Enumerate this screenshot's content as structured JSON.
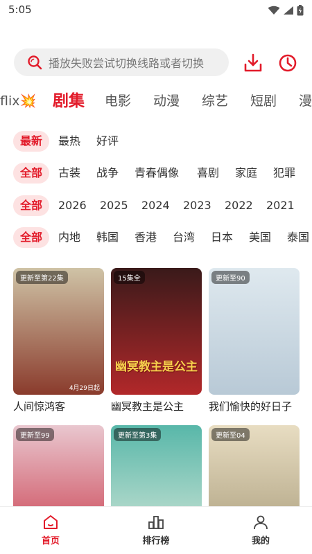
{
  "status": {
    "time": "5:05"
  },
  "search": {
    "placeholder": "播放失败尝试切换线路或者切换"
  },
  "tabs": [
    {
      "label": "flix💥"
    },
    {
      "label": "剧集",
      "active": true
    },
    {
      "label": "电影"
    },
    {
      "label": "动漫"
    },
    {
      "label": "综艺"
    },
    {
      "label": "短剧"
    },
    {
      "label": "漫"
    }
  ],
  "filters": {
    "sort": [
      "最新",
      "最热",
      "好评"
    ],
    "genre": [
      "全部",
      "古装",
      "战争",
      "青春偶像",
      "喜剧",
      "家庭",
      "犯罪"
    ],
    "year": [
      "全部",
      "2026",
      "2025",
      "2024",
      "2023",
      "2022",
      "2021"
    ],
    "region": [
      "全部",
      "内地",
      "韩国",
      "香港",
      "台湾",
      "日本",
      "美国",
      "泰国"
    ]
  },
  "cards": [
    {
      "title": "人间惊鸿客",
      "badge": "更新至第22集",
      "date": "4月29日起",
      "colors": [
        "#cfc3a6",
        "#8a3b2c"
      ]
    },
    {
      "title": "幽冥教主是公主",
      "badge": "15集全",
      "logo": "幽冥教主是公主",
      "colors": [
        "#3a1a1a",
        "#b2282a"
      ]
    },
    {
      "title": "我们愉快的好日子",
      "badge": "更新至90",
      "colors": [
        "#dfe9ef",
        "#b8c9d6"
      ]
    },
    {
      "title": "",
      "badge": "更新至99",
      "colors": [
        "#e9c7cf",
        "#c93a4b"
      ]
    },
    {
      "title": "",
      "badge": "更新至第3集",
      "colors": [
        "#58b7a9",
        "#d6e7d9"
      ]
    },
    {
      "title": "",
      "badge": "更新至04",
      "colors": [
        "#e8ddc2",
        "#a89b7a"
      ]
    }
  ],
  "bottom_nav": [
    {
      "label": "首页",
      "active": true
    },
    {
      "label": "排行榜"
    },
    {
      "label": "我的"
    }
  ],
  "colors": {
    "accent": "#e21b2a",
    "chip_bg": "#fde2e2"
  }
}
